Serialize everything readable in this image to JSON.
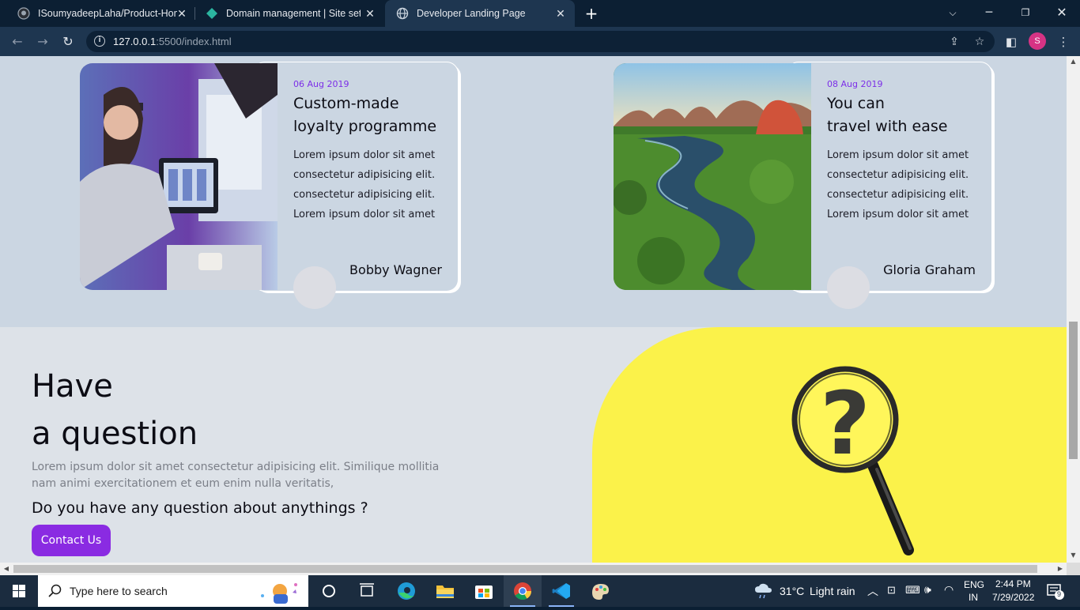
{
  "browser": {
    "tabs": [
      {
        "title": "ISoumyadeepLaha/Product-Hom",
        "icon": "github-icon",
        "active": false
      },
      {
        "title": "Domain management | Site settin",
        "icon": "netlify-icon",
        "active": false
      },
      {
        "title": "Developer Landing Page",
        "icon": "globe-icon",
        "active": true
      }
    ],
    "url_host": "127.0.0.1",
    "url_rest": ":5500/index.html",
    "profile_initial": "S"
  },
  "blog": {
    "cards": [
      {
        "date": "06 Aug 2019",
        "title_line1": "Custom-made",
        "title_line2": "loyalty programme",
        "body": [
          "Lorem ipsum dolor sit amet",
          "consectetur adipisicing elit.",
          "consectetur adipisicing elit.",
          "Lorem ipsum dolor sit amet"
        ],
        "author": "Bobby Wagner",
        "image": "developer-at-computer-photo"
      },
      {
        "date": "08 Aug 2019",
        "title_line1": "You can",
        "title_line2": "travel with ease",
        "body": [
          "Lorem ipsum dolor sit amet",
          "consectetur adipisicing elit.",
          "consectetur adipisicing elit.",
          "Lorem ipsum dolor sit amet"
        ],
        "author": "Gloria Graham",
        "image": "river-landscape-photo"
      }
    ]
  },
  "question": {
    "heading_line1": "Have",
    "heading_line2": "a question",
    "paragraph": "Lorem ipsum dolor sit amet consectetur adipisicing elit. Similique mollitia nam animi exercitationem et eum enim nulla veritatis,",
    "subheading": "Do you have any question about anythings ?",
    "button_label": "Contact Us",
    "image": "magnifying-glass-question-mark",
    "accent_color": "#8a2be2",
    "art_bg_color": "#fbf24a"
  },
  "taskbar": {
    "search_placeholder": "Type here to search",
    "weather_temp": "31°C",
    "weather_desc": "Light rain",
    "lang": "ENG",
    "region": "IN",
    "time": "2:44 PM",
    "date": "7/29/2022",
    "notification_count": "9"
  }
}
